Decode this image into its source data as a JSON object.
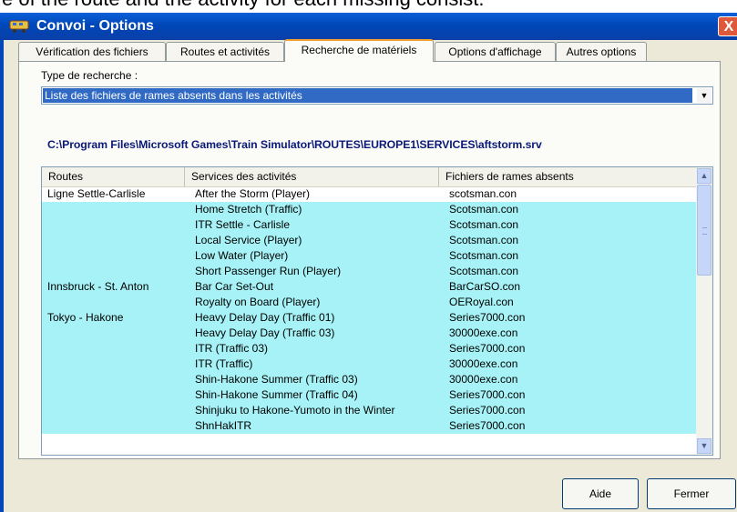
{
  "caption": "e of the route and the activity for each missing consist.",
  "window": {
    "title": "Convoi - Options",
    "close_label": "X"
  },
  "tabs": [
    {
      "label": "Vérification des fichiers"
    },
    {
      "label": "Routes et activités"
    },
    {
      "label": "Recherche de matériels",
      "active": true
    },
    {
      "label": "Options d'affichage"
    },
    {
      "label": "Autres options"
    }
  ],
  "search": {
    "type_label": "Type de recherche :",
    "selected": "Liste des fichiers de rames absents dans les activités"
  },
  "path": "C:\\Program Files\\Microsoft Games\\Train Simulator\\ROUTES\\EUROPE1\\SERVICES\\aftstorm.srv",
  "list": {
    "columns": [
      "Routes",
      "Services des activités",
      "Fichiers de rames absents"
    ],
    "rows": [
      {
        "route": "Ligne Settle-Carlisle",
        "service": "After the Storm (Player)",
        "file": "scotsman.con",
        "highlight": false
      },
      {
        "route": "",
        "service": "Home Stretch (Traffic)",
        "file": "Scotsman.con",
        "highlight": true
      },
      {
        "route": "",
        "service": "ITR Settle - Carlisle",
        "file": "Scotsman.con",
        "highlight": true
      },
      {
        "route": "",
        "service": "Local Service (Player)",
        "file": "Scotsman.con",
        "highlight": true
      },
      {
        "route": "",
        "service": "Low Water (Player)",
        "file": "Scotsman.con",
        "highlight": true
      },
      {
        "route": "",
        "service": "Short Passenger Run (Player)",
        "file": "Scotsman.con",
        "highlight": true
      },
      {
        "route": "Innsbruck - St. Anton",
        "service": "Bar Car Set-Out",
        "file": "BarCarSO.con",
        "highlight": true
      },
      {
        "route": "",
        "service": "Royalty on Board (Player)",
        "file": "OERoyal.con",
        "highlight": true
      },
      {
        "route": "Tokyo - Hakone",
        "service": "Heavy Delay Day (Traffic 01)",
        "file": "Series7000.con",
        "highlight": true
      },
      {
        "route": "",
        "service": "Heavy Delay Day (Traffic 03)",
        "file": "30000exe.con",
        "highlight": true
      },
      {
        "route": "",
        "service": "ITR (Traffic 03)",
        "file": "Series7000.con",
        "highlight": true
      },
      {
        "route": "",
        "service": "ITR (Traffic)",
        "file": "30000exe.con",
        "highlight": true
      },
      {
        "route": "",
        "service": "Shin-Hakone Summer (Traffic 03)",
        "file": "30000exe.con",
        "highlight": true
      },
      {
        "route": "",
        "service": "Shin-Hakone Summer (Traffic 04)",
        "file": "Series7000.con",
        "highlight": true
      },
      {
        "route": "",
        "service": "Shinjuku to Hakone-Yumoto in the Winter",
        "file": "Series7000.con",
        "highlight": true
      },
      {
        "route": "",
        "service": "ShnHakITR",
        "file": "Series7000.con",
        "highlight": true
      }
    ]
  },
  "buttons": {
    "help": "Aide",
    "close": "Fermer"
  },
  "colors": {
    "titlebar": "#0047b8",
    "selection": "#316ac5",
    "row_highlight": "#a6f2f6",
    "path_text": "#0b1a7a"
  }
}
